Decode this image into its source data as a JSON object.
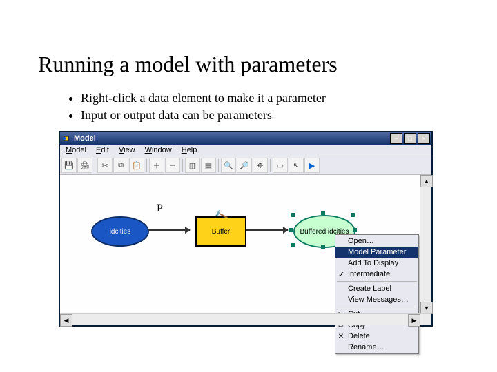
{
  "slide": {
    "title": "Running a model with parameters",
    "bullets": [
      "Right-click a data element to make it a parameter",
      "Input or output data can be parameters"
    ]
  },
  "window": {
    "title": "Model"
  },
  "menubar": {
    "model": "Model",
    "edit": "Edit",
    "view": "View",
    "window": "Window",
    "help": "Help"
  },
  "toolbar_icons": {
    "save": "💾",
    "print": "🖨",
    "cut": "✂",
    "copy": "⧉",
    "paste": "📋",
    "add": "＋",
    "remove": "－",
    "layout1": "▥",
    "layout2": "▤",
    "zoomin": "🔍",
    "zoomout": "🔎",
    "pan": "✥",
    "select": "▭",
    "pointer": "↖",
    "run": "▶"
  },
  "model": {
    "p_label": "P",
    "input": {
      "label": "idcities",
      "fill": "#1a56c4",
      "stroke": "#0b2b62",
      "text": "#e9eef8"
    },
    "tool": {
      "label": "Buffer",
      "fill": "#ffd21a",
      "stroke": "#000",
      "text": "#000"
    },
    "output": {
      "label": "Buffered idcities",
      "fill": "#c7ffd0",
      "stroke": "#0a7c62",
      "text": "#000"
    }
  },
  "context_menu": {
    "open": "Open…",
    "model_parameter": "Model Parameter",
    "add_to_display": "Add To Display",
    "intermediate": "Intermediate",
    "create_label": "Create Label",
    "view_messages": "View Messages…",
    "cut": "Cut",
    "copy": "Copy",
    "delete": "Delete",
    "rename": "Rename…"
  }
}
